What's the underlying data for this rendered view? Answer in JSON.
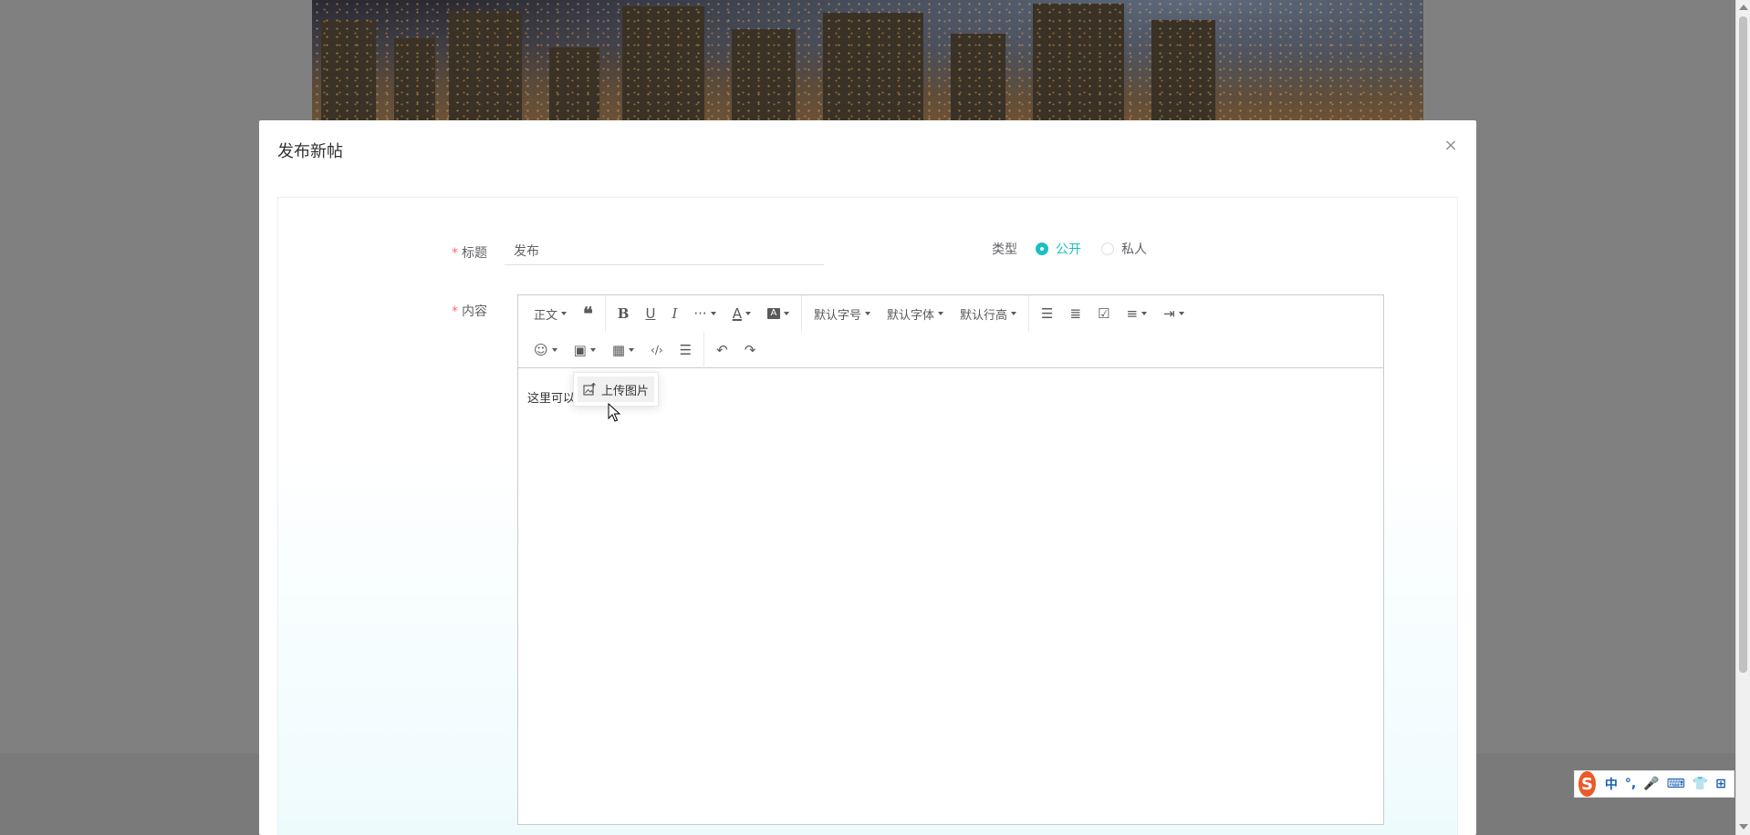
{
  "dialog": {
    "title": "发布新帖",
    "close_glyph": "×"
  },
  "form": {
    "title_label": "标题",
    "title_value": "发布",
    "type_label": "类型",
    "type_options": [
      {
        "label": "公开",
        "checked": true
      },
      {
        "label": "私人",
        "checked": false
      }
    ],
    "content_label": "内容",
    "required_mark": "*"
  },
  "toolbar": {
    "row1": [
      {
        "name": "heading-dropdown",
        "label": "正文",
        "dropdown": true
      },
      {
        "name": "quote-button",
        "glyph": "❝"
      },
      {
        "name": "bold-button",
        "glyph": "B"
      },
      {
        "name": "underline-button",
        "glyph": "U"
      },
      {
        "name": "italic-button",
        "glyph": "I"
      },
      {
        "name": "more-dropdown",
        "glyph": "···",
        "dropdown": true
      },
      {
        "name": "font-color-dropdown",
        "glyph": "A",
        "dropdown": true
      },
      {
        "name": "bg-color-dropdown",
        "glyph": "A",
        "dropdown": true
      },
      {
        "name": "font-size-dropdown",
        "label": "默认字号",
        "dropdown": true
      },
      {
        "name": "font-family-dropdown",
        "label": "默认字体",
        "dropdown": true
      },
      {
        "name": "line-height-dropdown",
        "label": "默认行高",
        "dropdown": true
      },
      {
        "name": "bullet-list-button",
        "glyph": "☰"
      },
      {
        "name": "numbered-list-button",
        "glyph": "≣"
      },
      {
        "name": "todo-button",
        "glyph": "☑"
      },
      {
        "name": "align-dropdown",
        "glyph": "≡",
        "dropdown": true
      },
      {
        "name": "indent-dropdown",
        "glyph": "⇥",
        "dropdown": true
      }
    ],
    "row2": [
      {
        "name": "emoji-dropdown",
        "glyph": "☺",
        "dropdown": true
      },
      {
        "name": "image-dropdown",
        "glyph": "▣",
        "dropdown": true
      },
      {
        "name": "table-dropdown",
        "glyph": "▦",
        "dropdown": true
      },
      {
        "name": "code-button",
        "glyph": "‹/›"
      },
      {
        "name": "divider-button",
        "glyph": "☰"
      },
      {
        "name": "undo-button",
        "glyph": "↶"
      },
      {
        "name": "redo-button",
        "glyph": "↷"
      }
    ]
  },
  "editor": {
    "placeholder_visible": "这里可以"
  },
  "image_menu": {
    "upload_label": "上传图片"
  },
  "ime": {
    "logo": "S",
    "items": [
      "中",
      "°,",
      "🎤",
      "⌨",
      "👕",
      "⊞"
    ]
  }
}
